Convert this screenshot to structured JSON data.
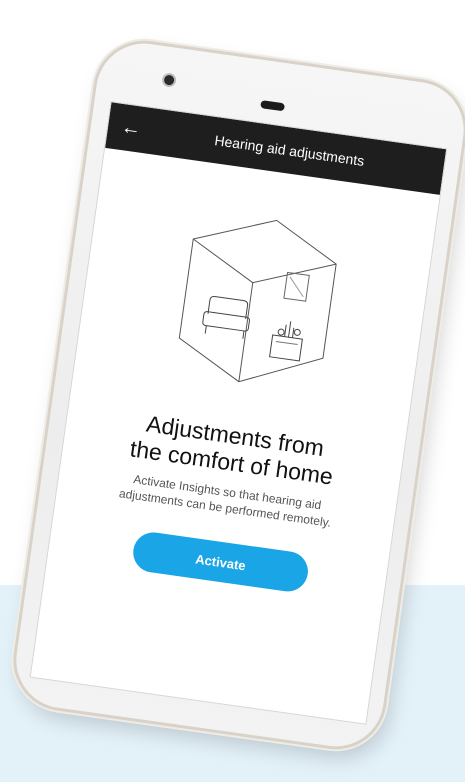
{
  "app_bar": {
    "title": "Hearing aid adjustments",
    "back_icon": "back-arrow-icon"
  },
  "content": {
    "illustration": "room-illustration",
    "heading_line1": "Adjustments from",
    "heading_line2": "the comfort of home",
    "body_line1": "Activate Insights so that hearing aid",
    "body_line2": "adjustments can be performed remotely.",
    "activate_label": "Activate"
  },
  "colors": {
    "app_bar_bg": "#1e1e1e",
    "button_bg": "#1aa6e6",
    "background_band": "#e3f1f9"
  }
}
